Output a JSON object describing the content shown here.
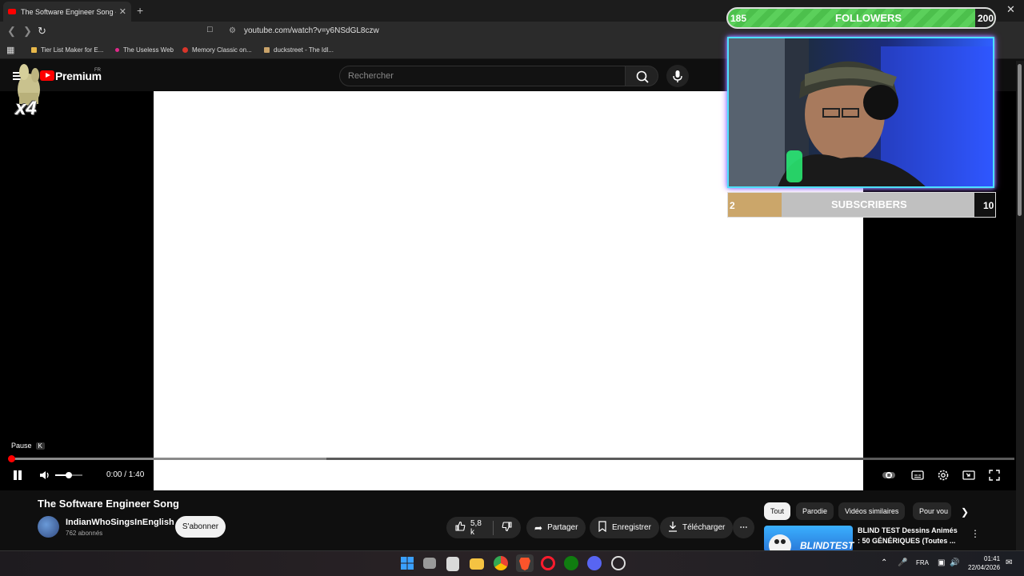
{
  "browser": {
    "tab_title": "The Software Engineer Song - Yo",
    "tab_close": "✕",
    "new_tab": "+",
    "window_close": "✕",
    "url": "youtube.com/watch?v=y6NSdGL8czw",
    "bookmarks": [
      {
        "label": "Tier List Maker for E...",
        "color": "#e8b84a"
      },
      {
        "label": "The Useless Web",
        "color": "#e0298a"
      },
      {
        "label": "Memory Classic on...",
        "color": "#d9352a"
      },
      {
        "label": "duckstreet - The Idl...",
        "color": "#c9a36a"
      }
    ]
  },
  "youtube": {
    "brand": "Premium",
    "region": "FR",
    "search_placeholder": "Rechercher"
  },
  "sticker": {
    "multiplier": "x4"
  },
  "player": {
    "tooltip": "Pause",
    "tooltip_key": "K",
    "time": "0:00 / 1:40",
    "played_fraction": 0.0,
    "buffered_fraction": 0.315,
    "volume_fraction": 0.5
  },
  "overlay": {
    "followers_current": "185",
    "followers_label": "FOLLOWERS",
    "followers_goal": "200",
    "subs_current": "2",
    "subs_label": "SUBSCRIBERS",
    "subs_goal": "10",
    "subs_fraction": 0.2
  },
  "video": {
    "title": "The Software Engineer Song",
    "channel": "IndianWhoSingsInEnglish",
    "subscribers": "762 abonnés",
    "subscribe": "S'abonner",
    "likes": "5,8 k",
    "share": "Partager",
    "save": "Enregistrer",
    "download": "Télécharger"
  },
  "chips": [
    "Tout",
    "Parodie",
    "Vidéos similaires",
    "Pour vou"
  ],
  "recommendation": {
    "thumb_text": "BLINDTEST",
    "title": "BLIND TEST Dessins Animés : 50 GÉNÉRIQUES (Toutes ..."
  },
  "taskbar": {
    "lang": "FRA",
    "time": "01:41",
    "date": "22/04/2026"
  },
  "colors": {
    "accent_red": "#ff0000",
    "followers_green": "#4cc04c",
    "subs_gold": "#cba66a",
    "webcam_border": "#4de0ff"
  }
}
